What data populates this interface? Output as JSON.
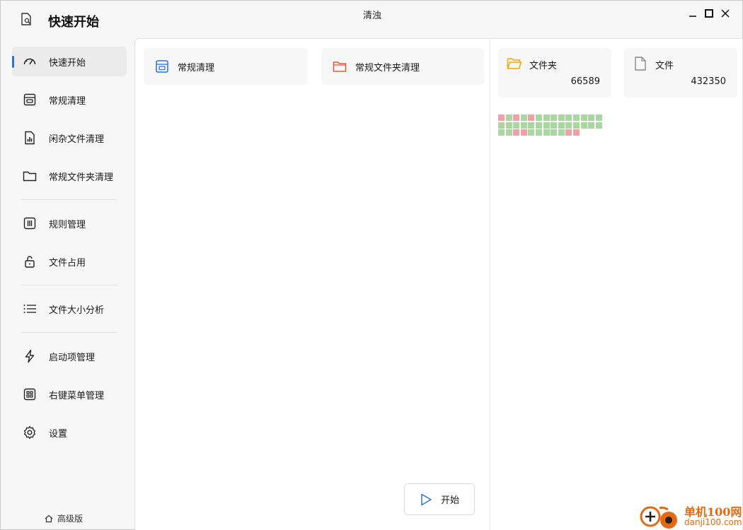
{
  "window": {
    "title": "清浊",
    "app_title": "快速开始"
  },
  "sidebar": {
    "items": [
      {
        "label": "快速开始",
        "icon": "speedometer-icon"
      },
      {
        "label": "常规清理",
        "icon": "cleanup-box-icon"
      },
      {
        "label": "闲杂文件清理",
        "icon": "file-chart-icon"
      },
      {
        "label": "常规文件夹清理",
        "icon": "folder-icon"
      },
      {
        "label": "规则管理",
        "icon": "rules-columns-icon"
      },
      {
        "label": "文件占用",
        "icon": "unlock-icon"
      },
      {
        "label": "文件大小分析",
        "icon": "list-icon"
      },
      {
        "label": "启动项管理",
        "icon": "lightning-icon"
      },
      {
        "label": "右键菜单管理",
        "icon": "grid-menu-icon"
      },
      {
        "label": "设置",
        "icon": "gear-icon"
      }
    ],
    "pro_label": "高级版"
  },
  "main": {
    "modes": [
      {
        "label": "常规清理",
        "icon": "cleanup-box-icon",
        "color": "#2f6fe0"
      },
      {
        "label": "常规文件夹清理",
        "icon": "folder-icon",
        "color": "#e8553f"
      }
    ],
    "stats": [
      {
        "label": "文件夹",
        "value": "66589",
        "icon": "folder-open-icon",
        "color": "#f0a800"
      },
      {
        "label": "文件",
        "value": "432350",
        "icon": "file-icon",
        "color": "#888888"
      }
    ],
    "status_grid": {
      "row1": [
        "bad",
        "ok",
        "bad",
        "ok",
        "bad",
        "ok",
        "ok",
        "ok",
        "ok",
        "ok",
        "ok",
        "ok",
        "ok",
        "ok"
      ],
      "row2": [
        "ok",
        "ok",
        "ok",
        "ok",
        "ok",
        "ok",
        "ok",
        "ok",
        "ok",
        "ok",
        "ok",
        "ok",
        "ok",
        "ok"
      ],
      "row3": [
        "ok",
        "ok",
        "bad",
        "bad",
        "ok",
        "ok",
        "ok",
        "ok",
        "ok",
        "bad",
        "bad"
      ]
    },
    "start_label": "开始"
  },
  "watermark": {
    "line1": "单机100网",
    "line2": "danji100.com"
  }
}
